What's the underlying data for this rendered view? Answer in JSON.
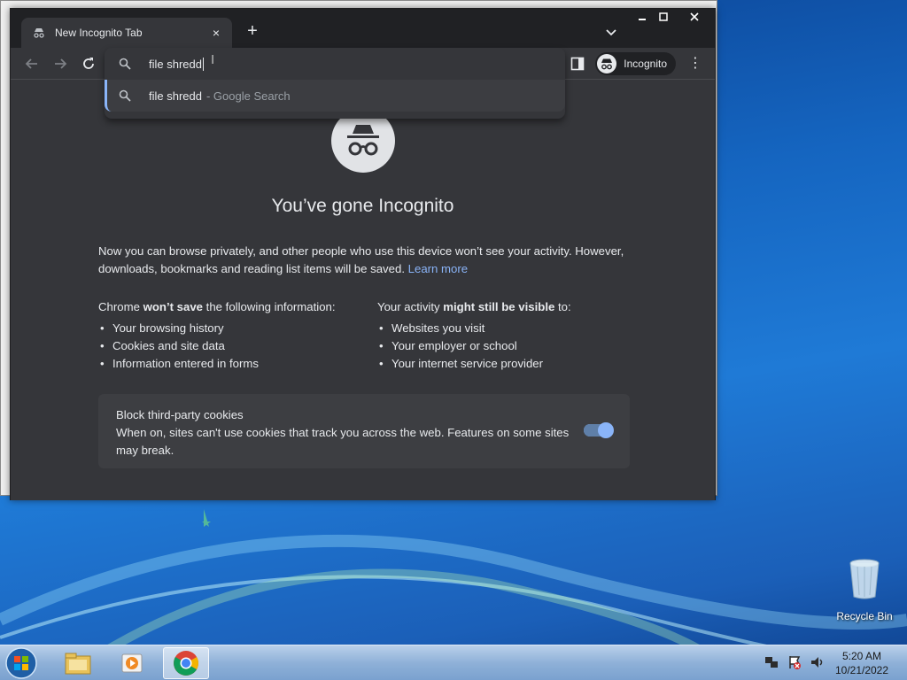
{
  "browser": {
    "tab_title": "New Incognito Tab",
    "tab_close": "×",
    "new_tab": "+",
    "omnibox_text": "file shredd",
    "suggestion_query": "file shredd",
    "suggestion_suffix": "- Google Search",
    "profile_label": "Incognito",
    "menu": "⋮"
  },
  "page": {
    "headline": "You’ve gone Incognito",
    "intro_text": "Now you can browse privately, and other people who use this device won’t see your activity. However, downloads, bookmarks and reading list items will be saved.",
    "learn_more": "Learn more",
    "left_heading_pre": "Chrome ",
    "left_heading_bold": "won’t save",
    "left_heading_post": " the following information:",
    "left_items": [
      "Your browsing history",
      "Cookies and site data",
      "Information entered in forms"
    ],
    "right_heading_pre": "Your activity ",
    "right_heading_bold": "might still be visible",
    "right_heading_post": " to:",
    "right_items": [
      "Websites you visit",
      "Your employer or school",
      "Your internet service provider"
    ],
    "cookie_title": "Block third-party cookies",
    "cookie_desc": "When on, sites can't use cookies that track you across the web. Features on some sites may break.",
    "cookie_toggle_on": true
  },
  "desktop": {
    "recycle_bin_label": "Recycle Bin"
  },
  "taskbar": {
    "time": "5:20 AM",
    "date": "10/21/2022"
  },
  "colors": {
    "accent": "#8ab4f8",
    "window_bg": "#35363a",
    "titlebar_bg": "#202124"
  }
}
